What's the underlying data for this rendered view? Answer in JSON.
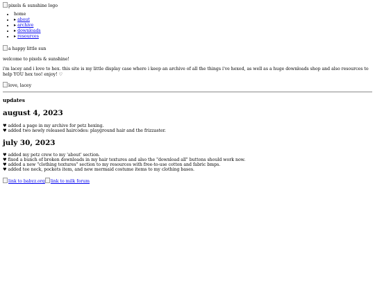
{
  "header": {
    "logo_alt": "pixels & sunshine logo"
  },
  "nav": {
    "arrow": "▸",
    "items": [
      {
        "label": "home"
      },
      {
        "label": "about"
      },
      {
        "label": "archive"
      },
      {
        "label": "downloads"
      },
      {
        "label": "resources"
      }
    ]
  },
  "sun_alt": "a happy little sun",
  "welcome": "welcome to pixels & sunshine!",
  "intro": "i'm lacey and i love to hex. this site is my little display case where i keep an archive of all the things i've hexed, as well as a huge downloads shop and also resources to help YOU hex too! enjoy! ♡",
  "signoff_alt": "love, lacey",
  "updates": {
    "heading": "updates",
    "posts": [
      {
        "date": "august 4, 2023",
        "entries": [
          "♥ added a page in my archive for petz hexing.",
          "♥ added two newly released haircodes: playground hair and the frizzaster."
        ]
      },
      {
        "date": "july 30, 2023",
        "entries": [
          "♥ added my petz crew to my 'about' section.",
          "♥ fixed a bunch of broken downloads in my hair textures and also the \"download all\" buttons should work now.",
          "♥ added a new \"clothing textures\" section to my resources with free-to-use cotton and fabric bmps.",
          "♥ added tee neck, pockets item, and new mermaid costume items to my clothing bases."
        ]
      }
    ]
  },
  "footer_buttons": [
    {
      "alt": "link to babyz.org"
    },
    {
      "alt": "link to milk forum"
    }
  ]
}
